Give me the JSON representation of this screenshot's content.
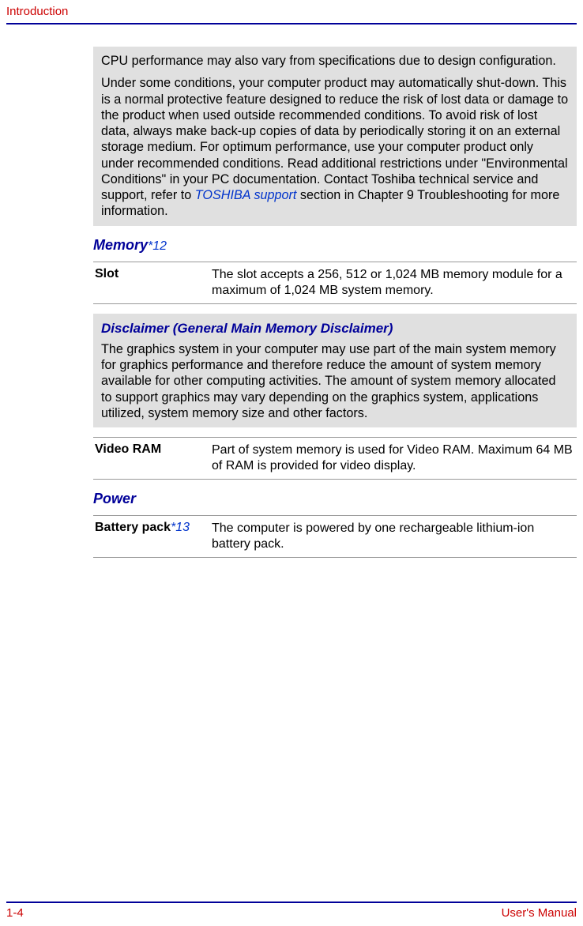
{
  "header": {
    "title": "Introduction"
  },
  "box1": {
    "p1": "CPU performance may also vary from specifications due to design configuration.",
    "p2a": "Under some conditions, your computer product may automatically shut-down. This is a normal protective feature designed to reduce the risk of lost data or damage to the product when used outside recommended conditions. To avoid risk of lost data, always make back-up copies of data by periodically storing it on an external storage medium. For optimum performance, use your computer product only under recommended conditions. Read additional restrictions under \"Environmental Conditions\" in your PC documentation. Contact Toshiba technical service and support, refer to ",
    "p2link": "TOSHIBA support",
    "p2b": " section in Chapter 9 Troubleshooting for more information."
  },
  "memory": {
    "heading": "Memory",
    "ref": "*12",
    "slot_label": "Slot",
    "slot_value": "The slot accepts a 256, 512 or 1,024 MB memory module for a maximum of 1,024 MB system memory."
  },
  "disclaimer": {
    "title": "Disclaimer (General Main Memory Disclaimer)",
    "body": "The graphics system in your computer may use part of the main system memory for graphics performance and therefore reduce the amount of system memory available for other computing activities. The amount of system memory allocated to support graphics may vary depending on the graphics system, applications utilized, system memory size and other factors."
  },
  "videoram": {
    "label": "Video RAM",
    "value": "Part of system memory is used for Video RAM. Maximum 64 MB of RAM is provided for video display."
  },
  "power": {
    "heading": "Power",
    "battery_label": "Battery pack",
    "battery_ref": "*13",
    "battery_value": "The computer is powered by one rechargeable lithium-ion battery pack."
  },
  "footer": {
    "page": "1-4",
    "manual": "User's Manual"
  }
}
